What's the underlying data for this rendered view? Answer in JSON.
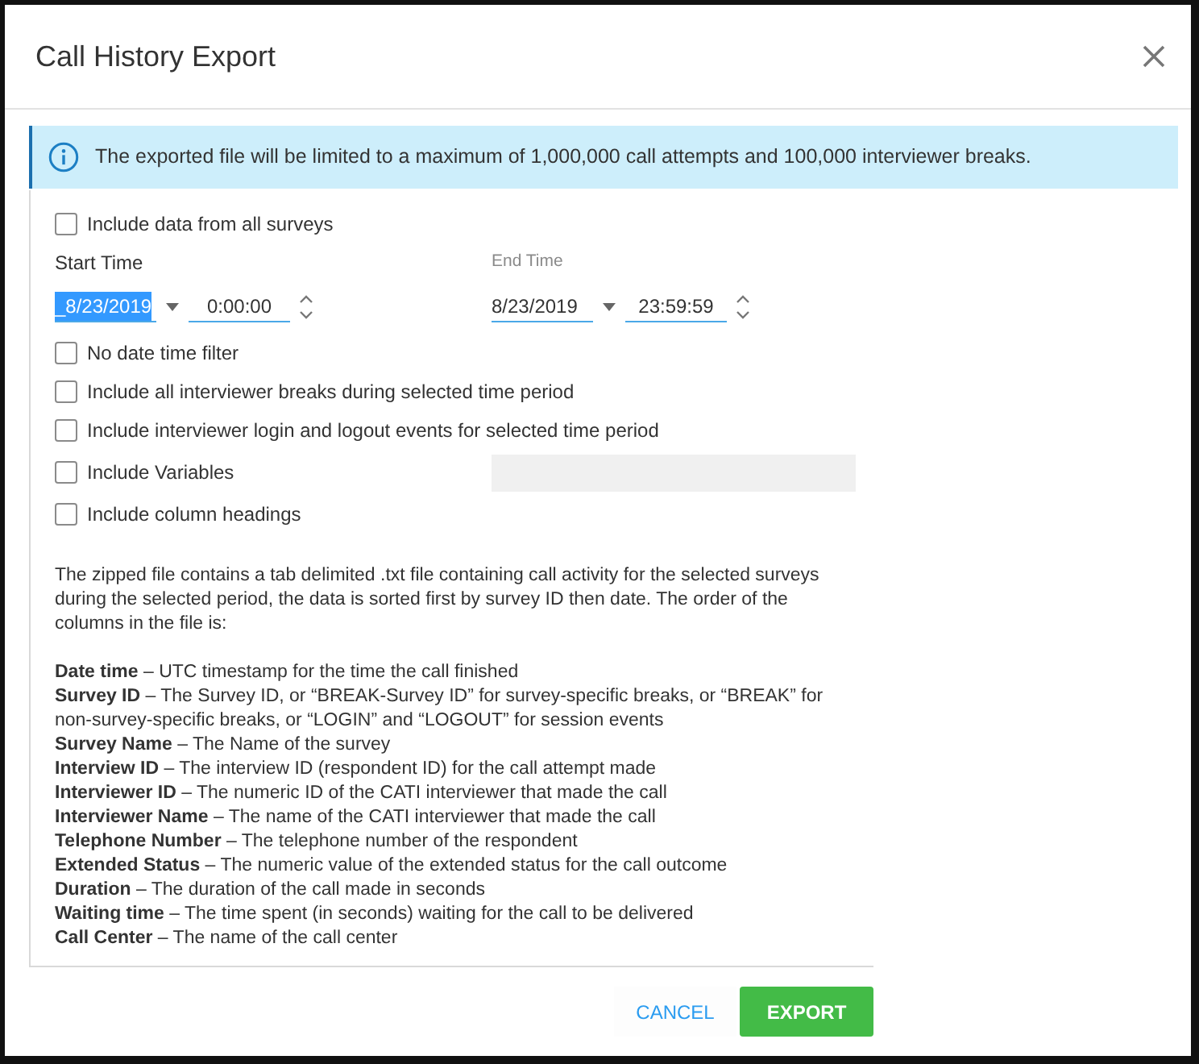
{
  "dialog": {
    "title": "Call History Export"
  },
  "notice": {
    "text": "The exported file will be limited to a maximum of 1,000,000 call attempts and 100,000 interviewer breaks."
  },
  "all_surveys": {
    "label": "Include data from all surveys",
    "checked": false
  },
  "start_time": {
    "label": "Start Time",
    "focused": true,
    "date": "_8/23/2019",
    "date_selected": true,
    "time": "0:00:00"
  },
  "end_time": {
    "label": "End Time",
    "focused": false,
    "date": "8/23/2019",
    "date_selected": false,
    "time": "23:59:59"
  },
  "options": [
    {
      "kind": "checkbox",
      "label": "No date time filter",
      "checked": false
    },
    {
      "kind": "checkbox",
      "label": "Include all interviewer breaks during selected time period",
      "checked": false
    },
    {
      "kind": "checkbox",
      "label": "Include interviewer login and logout events for selected time period",
      "checked": false
    },
    {
      "kind": "checkbox_field",
      "label": "Include Variables",
      "checked": false,
      "field_disabled": true
    },
    {
      "kind": "checkbox",
      "label": "Include column headings",
      "checked": false
    }
  ],
  "description": "The zipped file contains a tab delimited .txt file containing call activity for the selected surveys during the selected period, the data is sorted first by survey ID then date. The order of the columns in the file is:",
  "columns": [
    "**Date time** – UTC timestamp for the time the call finished",
    "**Survey ID** – The Survey ID, or “BREAK-Survey ID” for survey-specific breaks, or “BREAK” for non-survey-specific breaks, or “LOGIN” and “LOGOUT” for session events",
    "**Survey Name** – The Name of the survey",
    "**Interview ID** – The interview ID (respondent ID) for the call attempt made",
    "**Interviewer ID** – The numeric ID of the CATI interviewer that made the call",
    "**Interviewer Name** – The name of the CATI interviewer that made the call",
    "**Telephone Number** – The telephone number of the respondent",
    "**Extended Status** – The numeric value of the extended status for the call outcome",
    "**Duration** – The duration of the call made in seconds",
    "**Waiting time** – The time spent (in seconds) waiting for the call to be delivered",
    "**Call Center** – The name of the call center"
  ],
  "buttons": [
    {
      "kind": "text",
      "label": "CANCEL"
    },
    {
      "kind": "primary",
      "label": "EXPORT"
    }
  ]
}
